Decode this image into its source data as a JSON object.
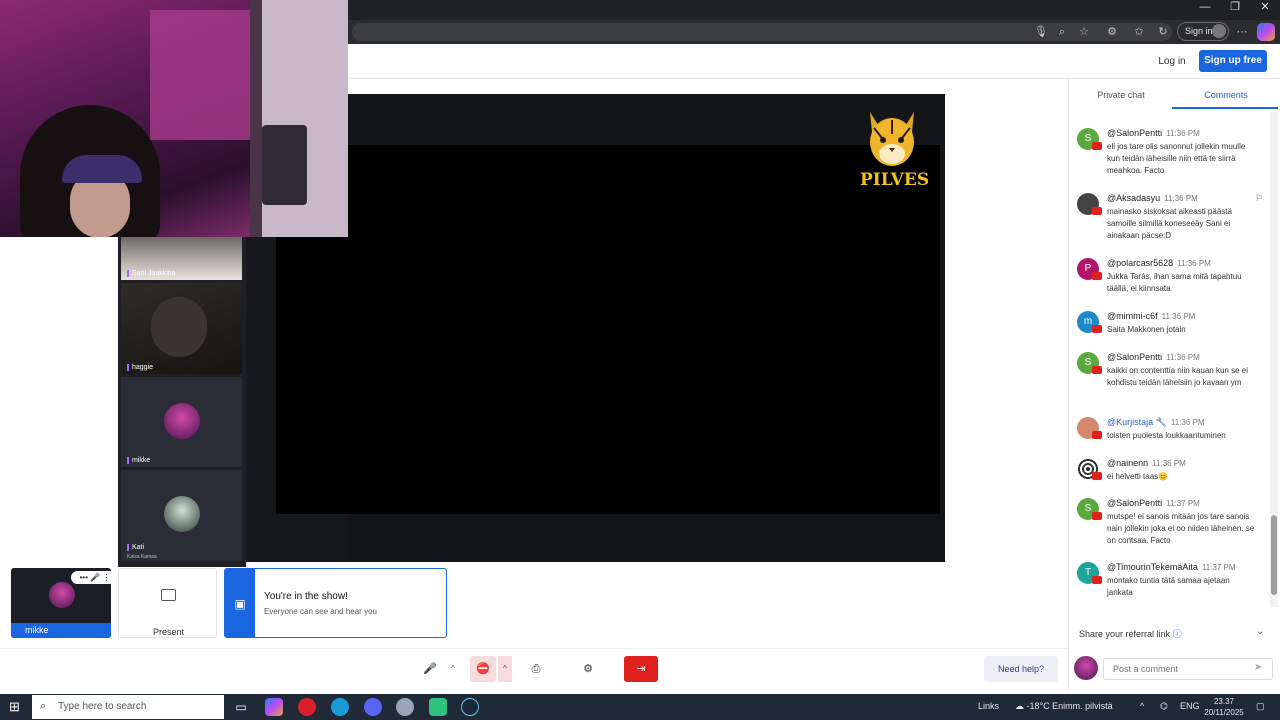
{
  "browser": {
    "signin_label": "Sign in",
    "icons": [
      "mic-icon",
      "zoom-icon",
      "star-icon",
      "extensions-icon",
      "favorites-icon",
      "history-icon",
      "more-icon"
    ],
    "window": {
      "minimize": "—",
      "restore": "❐",
      "close": "✕"
    }
  },
  "site_header": {
    "login_label": "Log in",
    "signup_label": "Sign up free"
  },
  "stage": {
    "logo_text": "PILVES"
  },
  "participants": {
    "tiles": [
      {
        "name": "Sani Jaakkina",
        "sub": ""
      },
      {
        "name": "haggie",
        "sub": ""
      },
      {
        "name": "mikke",
        "sub": ""
      },
      {
        "name": "Kati",
        "sub": "Kaisa Kamaa"
      }
    ],
    "self": {
      "name": "mikke",
      "ctrl": "••• 🎤 ⋮"
    },
    "present_label": "Present",
    "show_banner": {
      "title": "You're in the show!",
      "subtitle": "Everyone can see and hear you"
    }
  },
  "controls": {
    "mic": "🎤",
    "camera": "⛔",
    "share": "⎙",
    "settings": "⚙",
    "leave": "⇥",
    "caret": "^",
    "need_help": "Need help?"
  },
  "right_panel": {
    "tabs": [
      "Private chat",
      "Comments"
    ],
    "active_tab": "Comments",
    "comments": [
      {
        "user": "@SalonPentti",
        "time": "11:36 PM",
        "avatar": "S",
        "color": "#5aa93d",
        "text": "eli jos tare olis sanonnut jollekin muulle kun teidän läheisille niin että te siirrä meahkoa. Facto"
      },
      {
        "user": "@Aksadasyu",
        "time": "11:36 PM",
        "avatar": "",
        "color": "#444444",
        "text": "mainasko siskoksat aikeasti päästä samoille silmillä koneseeäy Sani ei ainakaan päcse:D"
      },
      {
        "user": "@polarcasr5628",
        "time": "11:36 PM",
        "avatar": "P",
        "color": "#b0156a",
        "text": "Jukka Tarás, ihan sama mitä tapahtuu täällä, ei kiinnsata"
      },
      {
        "user": "@mimmi-c6f",
        "time": "11:36 PM",
        "avatar": "m",
        "color": "#1e88c8",
        "text": "Saita Makkonen jotain"
      },
      {
        "user": "@SalonPentti",
        "time": "11:36 PM",
        "avatar": "S",
        "color": "#5aa93d",
        "text": "kaikki on contenttia niin kauan kun se ei kohdistu teidän läheisiin jo kavaan ym"
      },
      {
        "user": "@Kurjistaja 🔧",
        "time": "11:36 PM",
        "avatar": "",
        "color": "#d4896b",
        "text": "toisten puolesta loukkaantuminen"
      },
      {
        "user": "@nainenn",
        "time": "11:36 PM",
        "avatar": "",
        "color": "#666666",
        "text": "ei helvetti taas😊"
      },
      {
        "user": "@SalonPentti",
        "time": "11:37 PM",
        "avatar": "S",
        "color": "#5aa93d",
        "text": "mutspe! ei sanois mitään jos tare sanois nain jollekin joka ei oo niiden läheinen. se on contsaa. Facto"
      },
      {
        "user": "@TimourinTekemäAita",
        "time": "11:37 PM",
        "avatar": "T",
        "color": "#1ea69a",
        "text": "montako tuntia tätä samaa ajetaan jankata"
      }
    ],
    "referral_label": "Share your referral link",
    "post_placeholder": "Post a comment"
  },
  "taskbar": {
    "search_placeholder": "Type here to search",
    "links_label": "Links",
    "lang": "ENG",
    "weather": "-18°C  Enimm. pilvistä",
    "time": "23.37",
    "date": "20/11/2025"
  }
}
